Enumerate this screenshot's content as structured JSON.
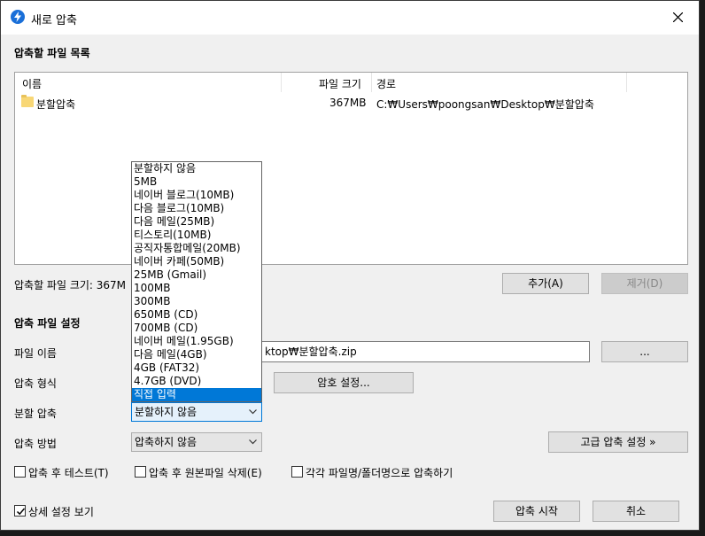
{
  "window": {
    "title": "새로 압축"
  },
  "file_section": {
    "title": "압축할 파일 목록",
    "columns": [
      "이름",
      "파일 크기",
      "경로"
    ],
    "rows": [
      {
        "name": "분할압축",
        "size": "367MB",
        "path": "C:₩Users₩poongsan₩Desktop₩분할압축"
      }
    ],
    "total_label": "압축할 파일 크기: 367M",
    "add_button": "추가(A)",
    "remove_button": "제거(D)"
  },
  "settings": {
    "title": "압축 파일 설정",
    "filename_label": "파일 이름",
    "filename_value": "ktop₩분할압축.zip",
    "browse_button": "...",
    "format_label": "압축 형식",
    "password_button": "암호 설정...",
    "split_label": "분할 압축",
    "split_value": "분할하지 않음",
    "method_label": "압축 방법",
    "method_value": "압축하지 않음",
    "advanced_button": "고급 압축 설정 »"
  },
  "options": {
    "test_after": "압축 후 테스트(T)",
    "delete_after": "압축 후 원본파일 삭제(E)",
    "each_name": "각각 파일명/폴더명으로 압축하기"
  },
  "footer": {
    "details": "상세 설정 보기",
    "details_checked": true,
    "start_button": "압축 시작",
    "cancel_button": "취소"
  },
  "split_dropdown": {
    "items": [
      "분할하지 않음",
      "5MB",
      "네이버 블로그(10MB)",
      "다음 블로그(10MB)",
      "다음 메일(25MB)",
      "티스토리(10MB)",
      "공직자통합메일(20MB)",
      "네이버 카페(50MB)",
      "25MB (Gmail)",
      "100MB",
      "300MB",
      "650MB (CD)",
      "700MB (CD)",
      "네이버 메일(1.95GB)",
      "다음 메일(4GB)",
      "4GB (FAT32)",
      "4.7GB (DVD)",
      "직접 입력"
    ],
    "highlighted": "직접 입력"
  },
  "colors": {
    "accent": "#0078d7",
    "app_icon": "#1a6fd8",
    "folder": "#f8d776"
  },
  "icons": [
    "app-icon",
    "close-icon",
    "folder-icon",
    "chevron-down-icon",
    "checkmark-icon"
  ]
}
